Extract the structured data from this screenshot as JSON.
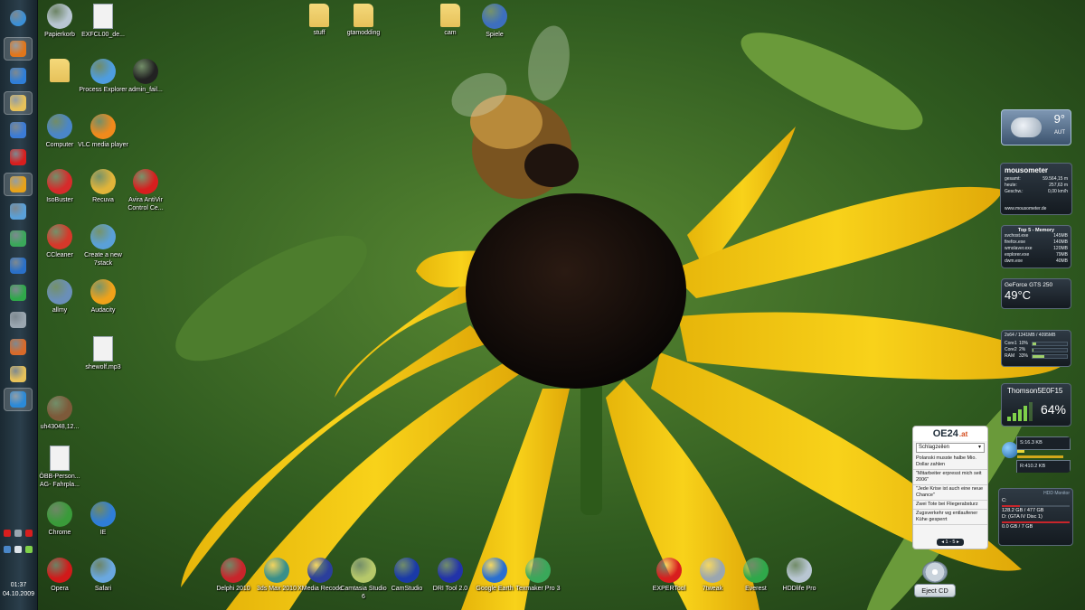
{
  "desktop": {
    "icons": [
      {
        "id": "papierkorb",
        "label": "Papierkorb",
        "icon": "recycle-bin-icon",
        "color": "#b8c6d2"
      },
      {
        "id": "exfcl",
        "label": "EXFCL00_de...",
        "icon": "document-icon",
        "color": "#f2f2f2"
      },
      {
        "id": "stuff",
        "label": "stuff",
        "icon": "folder-icon",
        "color": "#e6c15a"
      },
      {
        "id": "gtamodding",
        "label": "gtamodding",
        "icon": "folder-icon",
        "color": "#e6c15a"
      },
      {
        "id": "cam",
        "label": "cam",
        "icon": "folder-icon",
        "color": "#e6c15a"
      },
      {
        "id": "spiele",
        "label": "Spiele",
        "icon": "games-icon",
        "color": "#3d6fbf"
      },
      {
        "id": "userfolder",
        "label": "",
        "icon": "folder-icon",
        "color": "#e6c15a"
      },
      {
        "id": "procexp",
        "label": "Process Explorer",
        "icon": "process-explorer-icon",
        "color": "#4e9de0"
      },
      {
        "id": "adminfail",
        "label": "admin_fail...",
        "icon": "image-file-icon",
        "color": "#222222"
      },
      {
        "id": "computer",
        "label": "Computer",
        "icon": "computer-icon",
        "color": "#4a86c8"
      },
      {
        "id": "vlc",
        "label": "VLC media player",
        "icon": "vlc-icon",
        "color": "#f08a1c"
      },
      {
        "id": "isobuster",
        "label": "IsoBuster",
        "icon": "isobuster-icon",
        "color": "#d62b2b"
      },
      {
        "id": "recuva",
        "label": "Recuva",
        "icon": "recuva-icon",
        "color": "#e1b43a"
      },
      {
        "id": "avira",
        "label": "Avira AntiVir Control Ce...",
        "icon": "avira-icon",
        "color": "#d81e1e"
      },
      {
        "id": "ccleaner",
        "label": "CCleaner",
        "icon": "ccleaner-icon",
        "color": "#d6382a"
      },
      {
        "id": "7stack",
        "label": "Create a new 7stack",
        "icon": "7stack-icon",
        "color": "#5aa0d8"
      },
      {
        "id": "allmy",
        "label": "allmy",
        "icon": "allmy-icon",
        "color": "#6a8fb8"
      },
      {
        "id": "audacity",
        "label": "Audacity",
        "icon": "audacity-icon",
        "color": "#f0a21a"
      },
      {
        "id": "shewolf",
        "label": "shewolf.mp3",
        "icon": "mp3-file-icon",
        "color": "#f2f2f2"
      },
      {
        "id": "uh43048",
        "label": "uh43048,12...",
        "icon": "image-file-icon",
        "color": "#7d5a3a"
      },
      {
        "id": "oebb",
        "label": "ÖBB-Person... AG- Fahrpla...",
        "icon": "document-icon",
        "color": "#f2f2f2"
      },
      {
        "id": "chrome",
        "label": "Chrome",
        "icon": "chrome-icon",
        "color": "#3a9b3a"
      },
      {
        "id": "ie",
        "label": "IE",
        "icon": "internet-explorer-icon",
        "color": "#2f7ed8"
      },
      {
        "id": "opera",
        "label": "Opera",
        "icon": "opera-icon",
        "color": "#d11a1a"
      },
      {
        "id": "safari",
        "label": "Safari",
        "icon": "safari-icon",
        "color": "#6aa8e0"
      },
      {
        "id": "delphi",
        "label": "Delphi 2010",
        "icon": "delphi-icon",
        "color": "#c8252b"
      },
      {
        "id": "3dsmax",
        "label": "3ds Max 2010",
        "icon": "3ds-max-icon",
        "color": "#3a8f8a"
      },
      {
        "id": "xmedia",
        "label": "XMedia Recode",
        "icon": "xmedia-recode-icon",
        "color": "#2b3f9c"
      },
      {
        "id": "camtasia",
        "label": "Camtasia Studio 6",
        "icon": "camtasia-icon",
        "color": "#b6c86a"
      },
      {
        "id": "camstudio",
        "label": "CamStudio",
        "icon": "camstudio-icon",
        "color": "#1a3aa8"
      },
      {
        "id": "dritool",
        "label": "DRI Tool 2.0",
        "icon": "dri-tool-icon",
        "color": "#2233aa"
      },
      {
        "id": "googleearth",
        "label": "Google Earth",
        "icon": "google-earth-icon",
        "color": "#2a6fd0"
      },
      {
        "id": "texmaker",
        "label": "Texmaker Pro 3",
        "icon": "texmaker-icon",
        "color": "#3aa85a"
      },
      {
        "id": "experttool",
        "label": "EXPERTool",
        "icon": "expertool-icon",
        "color": "#d81e1e"
      },
      {
        "id": "7tweak",
        "label": "7tweak",
        "icon": "7tweak-icon",
        "color": "#9aa6b0"
      },
      {
        "id": "everest",
        "label": "Everest",
        "icon": "everest-icon",
        "color": "#2fa84a"
      },
      {
        "id": "hddlife",
        "label": "HDDlife Pro",
        "icon": "hddlife-icon",
        "color": "#b8c6d2"
      }
    ]
  },
  "taskbar": {
    "buttons": [
      {
        "icon": "windows-start-icon",
        "color": "#3b8fd6",
        "active": false
      },
      {
        "icon": "firefox-icon",
        "color": "#e2761b",
        "active": true
      },
      {
        "icon": "ie-icon",
        "color": "#2f7ed8",
        "active": false
      },
      {
        "icon": "explorer-folder-icon",
        "color": "#e6c15a",
        "active": true
      },
      {
        "icon": "windows-update-icon",
        "color": "#3b7bd6",
        "active": false
      },
      {
        "icon": "pdf-icon",
        "color": "#d81e1e",
        "active": false
      },
      {
        "icon": "media-player-icon",
        "color": "#e8a21a",
        "active": true
      },
      {
        "icon": "download-arrow-icon",
        "color": "#5aa0d8",
        "active": false
      },
      {
        "icon": "windows-logo-icon",
        "color": "#3aa85a",
        "active": false
      },
      {
        "icon": "photoshop-icon",
        "color": "#2a70c8",
        "active": false
      },
      {
        "icon": "ccleaner-icon",
        "color": "#2fa84a",
        "active": false
      },
      {
        "icon": "monitor-icon",
        "color": "#9aa6b0",
        "active": false
      },
      {
        "icon": "paint-icon",
        "color": "#d86a2a",
        "active": false
      },
      {
        "icon": "photo-gallery-icon",
        "color": "#e6c15a",
        "active": false
      },
      {
        "icon": "download-manager-icon",
        "color": "#2b8ad8",
        "active": true
      }
    ],
    "tray": [
      {
        "icon": "avira-tray-icon",
        "color": "#d81e1e"
      },
      {
        "icon": "network-tray-icon",
        "color": "#9aa6b0"
      },
      {
        "icon": "flag-tray-icon",
        "color": "#d81e1e"
      },
      {
        "icon": "info-tray-icon",
        "color": "#4a86c8"
      },
      {
        "icon": "volume-tray-icon",
        "color": "#dde4ea"
      },
      {
        "icon": "signal-tray-icon",
        "color": "#7fd14a"
      }
    ],
    "clock": {
      "time": "01:37",
      "date": "04.10.2009"
    }
  },
  "gadgets": {
    "weather": {
      "temp": "9°",
      "location": "AUT"
    },
    "mousometer": {
      "title": "mousometer",
      "rows": [
        {
          "k": "gesamt:",
          "v": "59.564,15 m"
        },
        {
          "k": "heute:",
          "v": "257,63 m"
        },
        {
          "k": "Geschw.:",
          "v": "0,00 km/h"
        }
      ],
      "site": "www.mousometer.de"
    },
    "memory": {
      "title": "Top 5 - Memory",
      "rows": [
        {
          "p": "svchost.exe",
          "m": "145MB"
        },
        {
          "p": "firefox.exe",
          "m": "140MB"
        },
        {
          "p": "wmolaver.exe",
          "m": "120MB"
        },
        {
          "p": "explorer.exe",
          "m": "79MB"
        },
        {
          "p": "dwm.exe",
          "m": "40MB"
        }
      ]
    },
    "gpu": {
      "name": "GeForce GTS 250",
      "temp": "49°C"
    },
    "cpu": {
      "header": "2x64 / 1341MB / 4095MB",
      "rows": [
        {
          "k": "Core1",
          "v": "10%",
          "level": 0.1
        },
        {
          "k": "Core2",
          "v": "2%",
          "level": 0.02
        },
        {
          "k": "RAM",
          "v": "33%",
          "level": 0.33
        }
      ]
    },
    "wifi": {
      "name": "Thomson5E0F15",
      "pct": "64%",
      "level": 0.64
    },
    "network": {
      "down": "S:16.3 KB",
      "up": "R:410.2 KB",
      "down_level": 0.15,
      "up_level": 0.95
    },
    "hdd": {
      "title": "HDD Monitor",
      "drives": [
        {
          "label": "C:",
          "size": "128.2 GB / 477 GB",
          "level": 0.27
        },
        {
          "label": "D: (GTA IV Disc 1)",
          "size": "0.0 GB / 7 GB",
          "level": 1.0
        }
      ]
    },
    "news": {
      "brand_main": "OE24",
      "brand_suffix": ".at",
      "select": "Schlagzeilen",
      "items": [
        "Polanski musste halbe Mio. Dollar zahlen",
        "\"Mitarbeiter erpresst mich seit 2006\"",
        "\"Jede Krise ist auch eine neue Chance\"",
        "Zwei Tote bei Fliegerabsturz",
        "Zugsverkehr wg entlaufener Kühe gesperrt"
      ],
      "pager": "1 - 5"
    },
    "eject": {
      "label": "Eject CD"
    }
  }
}
